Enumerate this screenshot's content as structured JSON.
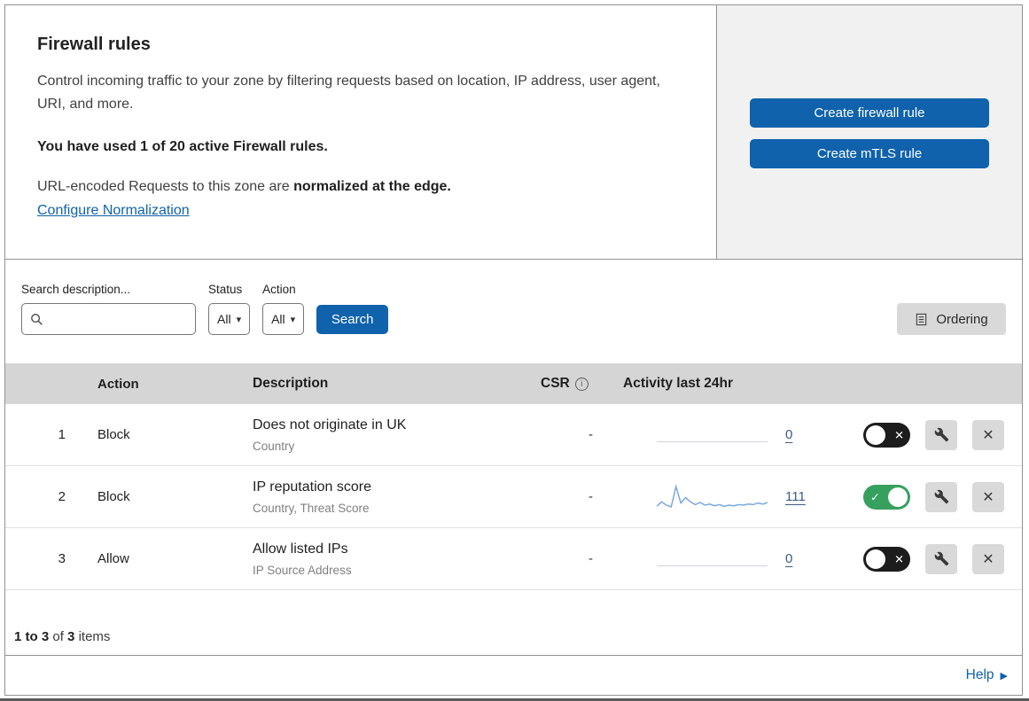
{
  "colors": {
    "primary_blue": "#0f62ab",
    "toggle_green": "#36a05f",
    "sparkline_blue": "#7aa7e0"
  },
  "icons": {
    "caret_down": "▾",
    "close": "✕",
    "check": "✓",
    "help_arrow": "▶",
    "info": "i"
  },
  "header": {
    "title": "Firewall rules",
    "description": "Control incoming traffic to your zone by filtering requests based on location, IP address, user agent, URI, and more.",
    "usage": "You have used 1 of 20 active Firewall rules.",
    "normalization_prefix": "URL-encoded Requests to this zone are ",
    "normalization_bold": "normalized at the edge.",
    "normalization_link": "Configure Normalization",
    "create_firewall_button": "Create firewall rule",
    "create_mtls_button": "Create mTLS rule"
  },
  "filters": {
    "search_label": "Search description...",
    "status_label": "Status",
    "status_value": "All",
    "action_label": "Action",
    "action_value": "All",
    "search_button": "Search",
    "ordering_button": "Ordering"
  },
  "table": {
    "headers": {
      "action": "Action",
      "description": "Description",
      "csr": "CSR",
      "activity": "Activity last 24hr"
    },
    "rows": [
      {
        "index": "1",
        "action": "Block",
        "description": "Does not originate in UK",
        "criteria": "Country",
        "csr": "-",
        "activity_count": "0",
        "enabled": false
      },
      {
        "index": "2",
        "action": "Block",
        "description": "IP reputation score",
        "criteria": "Country, Threat Score",
        "csr": "-",
        "activity_count": "111",
        "enabled": true
      },
      {
        "index": "3",
        "action": "Allow",
        "description": "Allow listed IPs",
        "criteria": "IP Source Address",
        "csr": "-",
        "activity_count": "0",
        "enabled": false
      }
    ]
  },
  "chart_data": {
    "type": "line",
    "title": "Activity last 24hr sparkline for rule 'IP reputation score'",
    "values": [
      6,
      14,
      8,
      5,
      42,
      12,
      22,
      14,
      9,
      13,
      8,
      10,
      7,
      9,
      6,
      8,
      7,
      9,
      8,
      10,
      9,
      12,
      10,
      13
    ],
    "total": 111
  },
  "footer": {
    "range": "1 to 3",
    "of_text": "of",
    "total": "3",
    "items_text": "items",
    "help_label": "Help"
  }
}
